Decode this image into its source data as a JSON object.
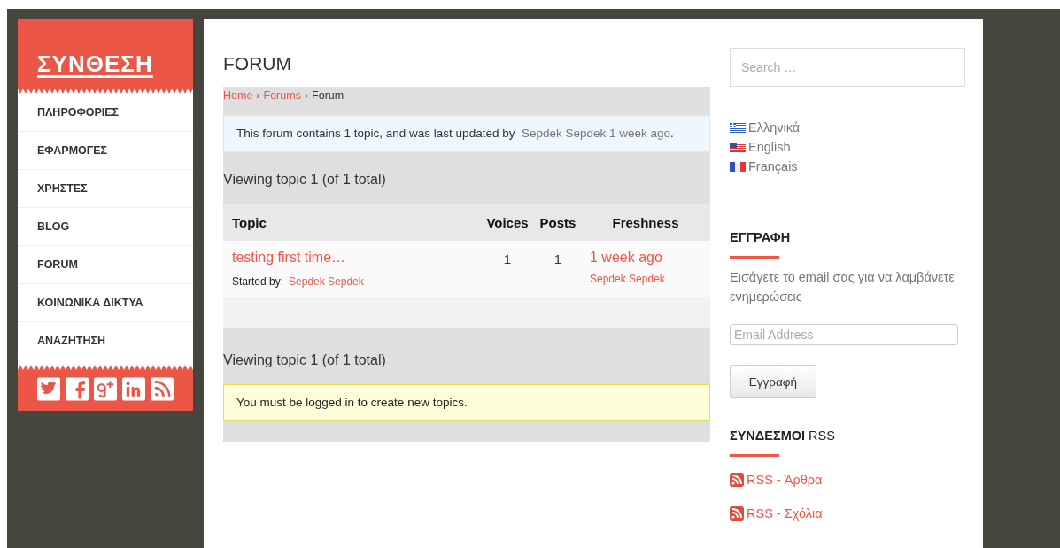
{
  "site_title": "ΣΥΝΘΕΣΗ",
  "nav": [
    {
      "label": "ΠΛΗΡΟΦΟΡΙΕΣ"
    },
    {
      "label": "ΕΦΑΡΜΟΓΕΣ"
    },
    {
      "label": "ΧΡΗΣΤΕΣ"
    },
    {
      "label": "BLOG"
    },
    {
      "label": "FORUM"
    },
    {
      "label": "ΚΟΙΝΩΝΙΚΑ ΔΙΚΤΥΑ"
    },
    {
      "label": "ΑΝΑΖΗΤΗΣΗ"
    }
  ],
  "social": [
    {
      "kind": "twitter"
    },
    {
      "kind": "facebook"
    },
    {
      "kind": "googleplus"
    },
    {
      "kind": "linkedin"
    },
    {
      "kind": "rss"
    }
  ],
  "page_title": "FORUM",
  "breadcrumb_separator": "›",
  "breadcrumb": [
    {
      "label": "Home",
      "kind": "link"
    },
    {
      "label": "Forums",
      "kind": "link"
    },
    {
      "label": "Forum",
      "kind": "current"
    }
  ],
  "info": {
    "text": "This forum contains 1 topic, and was last updated by",
    "author": "Sepdek Sepdek",
    "time": "1 week ago",
    "end": "."
  },
  "viewing_top": "Viewing topic 1 (of 1 total)",
  "table": {
    "columns": [
      "Topic",
      "Voices",
      "Posts",
      "Freshness"
    ],
    "rows": [
      {
        "title": "testing first time…",
        "started_label": "Started by:",
        "author": "Sepdek Sepdek",
        "voices": "1",
        "posts": "1",
        "freshness": "1 week ago",
        "last_author": "Sepdek Sepdek"
      }
    ]
  },
  "viewing_bottom": "Viewing topic 1 (of 1 total)",
  "notice": "You must be logged in to create new topics.",
  "sidebar": {
    "search_placeholder": "Search …",
    "languages": [
      {
        "label": "Ελληνικά",
        "kind": "gr"
      },
      {
        "label": "English",
        "kind": "us"
      },
      {
        "label": "Français",
        "kind": "fr"
      }
    ],
    "subscribe": {
      "heading": "ΕΓΓΡΑΦΗ",
      "text": "Εισάγετε το email σας για να λαμβάνετε ενημερώσεις",
      "placeholder": "Email Address",
      "button": "Εγγραφή"
    },
    "rss": {
      "heading": "**ΣΥΝΔΕΣΜΟΙ** RSS",
      "links": [
        "RSS - Άρθρα",
        "RSS - Σχόλια"
      ]
    }
  }
}
